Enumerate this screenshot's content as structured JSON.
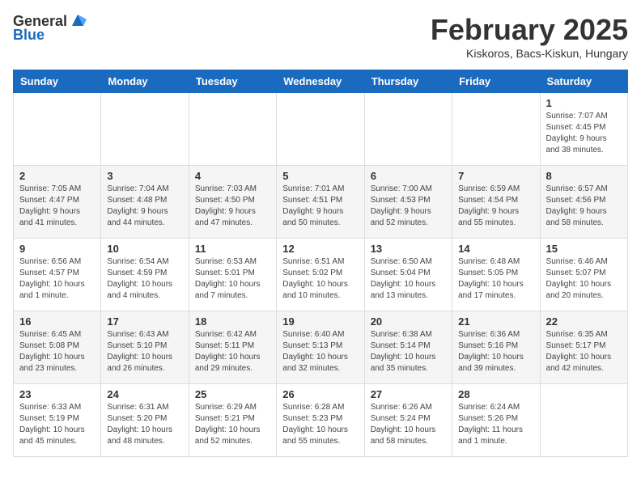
{
  "header": {
    "logo_general": "General",
    "logo_blue": "Blue",
    "title": "February 2025",
    "subtitle": "Kiskoros, Bacs-Kiskun, Hungary"
  },
  "days_of_week": [
    "Sunday",
    "Monday",
    "Tuesday",
    "Wednesday",
    "Thursday",
    "Friday",
    "Saturday"
  ],
  "weeks": [
    [
      {
        "day": "",
        "info": ""
      },
      {
        "day": "",
        "info": ""
      },
      {
        "day": "",
        "info": ""
      },
      {
        "day": "",
        "info": ""
      },
      {
        "day": "",
        "info": ""
      },
      {
        "day": "",
        "info": ""
      },
      {
        "day": "1",
        "info": "Sunrise: 7:07 AM\nSunset: 4:45 PM\nDaylight: 9 hours\nand 38 minutes."
      }
    ],
    [
      {
        "day": "2",
        "info": "Sunrise: 7:05 AM\nSunset: 4:47 PM\nDaylight: 9 hours\nand 41 minutes."
      },
      {
        "day": "3",
        "info": "Sunrise: 7:04 AM\nSunset: 4:48 PM\nDaylight: 9 hours\nand 44 minutes."
      },
      {
        "day": "4",
        "info": "Sunrise: 7:03 AM\nSunset: 4:50 PM\nDaylight: 9 hours\nand 47 minutes."
      },
      {
        "day": "5",
        "info": "Sunrise: 7:01 AM\nSunset: 4:51 PM\nDaylight: 9 hours\nand 50 minutes."
      },
      {
        "day": "6",
        "info": "Sunrise: 7:00 AM\nSunset: 4:53 PM\nDaylight: 9 hours\nand 52 minutes."
      },
      {
        "day": "7",
        "info": "Sunrise: 6:59 AM\nSunset: 4:54 PM\nDaylight: 9 hours\nand 55 minutes."
      },
      {
        "day": "8",
        "info": "Sunrise: 6:57 AM\nSunset: 4:56 PM\nDaylight: 9 hours\nand 58 minutes."
      }
    ],
    [
      {
        "day": "9",
        "info": "Sunrise: 6:56 AM\nSunset: 4:57 PM\nDaylight: 10 hours\nand 1 minute."
      },
      {
        "day": "10",
        "info": "Sunrise: 6:54 AM\nSunset: 4:59 PM\nDaylight: 10 hours\nand 4 minutes."
      },
      {
        "day": "11",
        "info": "Sunrise: 6:53 AM\nSunset: 5:01 PM\nDaylight: 10 hours\nand 7 minutes."
      },
      {
        "day": "12",
        "info": "Sunrise: 6:51 AM\nSunset: 5:02 PM\nDaylight: 10 hours\nand 10 minutes."
      },
      {
        "day": "13",
        "info": "Sunrise: 6:50 AM\nSunset: 5:04 PM\nDaylight: 10 hours\nand 13 minutes."
      },
      {
        "day": "14",
        "info": "Sunrise: 6:48 AM\nSunset: 5:05 PM\nDaylight: 10 hours\nand 17 minutes."
      },
      {
        "day": "15",
        "info": "Sunrise: 6:46 AM\nSunset: 5:07 PM\nDaylight: 10 hours\nand 20 minutes."
      }
    ],
    [
      {
        "day": "16",
        "info": "Sunrise: 6:45 AM\nSunset: 5:08 PM\nDaylight: 10 hours\nand 23 minutes."
      },
      {
        "day": "17",
        "info": "Sunrise: 6:43 AM\nSunset: 5:10 PM\nDaylight: 10 hours\nand 26 minutes."
      },
      {
        "day": "18",
        "info": "Sunrise: 6:42 AM\nSunset: 5:11 PM\nDaylight: 10 hours\nand 29 minutes."
      },
      {
        "day": "19",
        "info": "Sunrise: 6:40 AM\nSunset: 5:13 PM\nDaylight: 10 hours\nand 32 minutes."
      },
      {
        "day": "20",
        "info": "Sunrise: 6:38 AM\nSunset: 5:14 PM\nDaylight: 10 hours\nand 35 minutes."
      },
      {
        "day": "21",
        "info": "Sunrise: 6:36 AM\nSunset: 5:16 PM\nDaylight: 10 hours\nand 39 minutes."
      },
      {
        "day": "22",
        "info": "Sunrise: 6:35 AM\nSunset: 5:17 PM\nDaylight: 10 hours\nand 42 minutes."
      }
    ],
    [
      {
        "day": "23",
        "info": "Sunrise: 6:33 AM\nSunset: 5:19 PM\nDaylight: 10 hours\nand 45 minutes."
      },
      {
        "day": "24",
        "info": "Sunrise: 6:31 AM\nSunset: 5:20 PM\nDaylight: 10 hours\nand 48 minutes."
      },
      {
        "day": "25",
        "info": "Sunrise: 6:29 AM\nSunset: 5:21 PM\nDaylight: 10 hours\nand 52 minutes."
      },
      {
        "day": "26",
        "info": "Sunrise: 6:28 AM\nSunset: 5:23 PM\nDaylight: 10 hours\nand 55 minutes."
      },
      {
        "day": "27",
        "info": "Sunrise: 6:26 AM\nSunset: 5:24 PM\nDaylight: 10 hours\nand 58 minutes."
      },
      {
        "day": "28",
        "info": "Sunrise: 6:24 AM\nSunset: 5:26 PM\nDaylight: 11 hours\nand 1 minute."
      },
      {
        "day": "",
        "info": ""
      }
    ]
  ]
}
